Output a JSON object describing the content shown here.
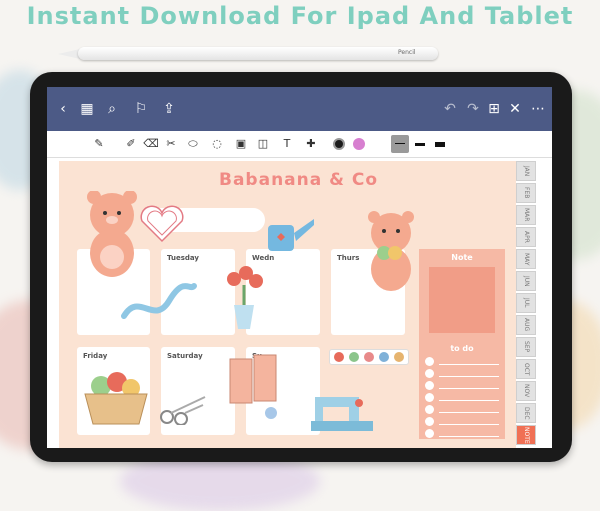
{
  "headline": "Instant Download For Ipad And Tablet",
  "pencil_brand": "Pencil",
  "topbar": {
    "icons": [
      "back-icon",
      "grid-icon",
      "search-icon",
      "bookmark-icon",
      "share-icon",
      "undo-icon",
      "redo-icon",
      "add-page-icon",
      "close-icon",
      "more-icon"
    ],
    "back": "‹",
    "grid": "▦",
    "search": "⌕",
    "bookmark": "⚐",
    "share": "⇪",
    "undo": "↶",
    "redo": "↷",
    "add_page": "⊞",
    "close": "✕",
    "more": "⋯"
  },
  "toolbar": {
    "tools": [
      "✎",
      "✐",
      "⌫",
      "✂",
      "⬭",
      "◌",
      "▣",
      "◫",
      "T",
      "✚"
    ],
    "colors": [
      "#1c1c1c",
      "#d77fd0"
    ],
    "line_color": "#9a9a9a"
  },
  "planner": {
    "title": "Babanana & Co",
    "days": {
      "tuesday": "Tuesday",
      "wednesday": "Wedn",
      "thursday": "Thurs",
      "friday": "Friday",
      "saturday": "Saturday",
      "sunday": "Su"
    },
    "note_label": "Note",
    "todo_label": "to do"
  },
  "tabs": [
    "JAN",
    "FEB",
    "MAR",
    "APR",
    "MAY",
    "JUN",
    "JUL",
    "AUG",
    "SEP",
    "OCT",
    "NOV",
    "DEC",
    "NOTE"
  ],
  "palette_colors": [
    "#e76b5b",
    "#8bc58b",
    "#e88a8a",
    "#7fb1d8",
    "#e6b46f"
  ]
}
